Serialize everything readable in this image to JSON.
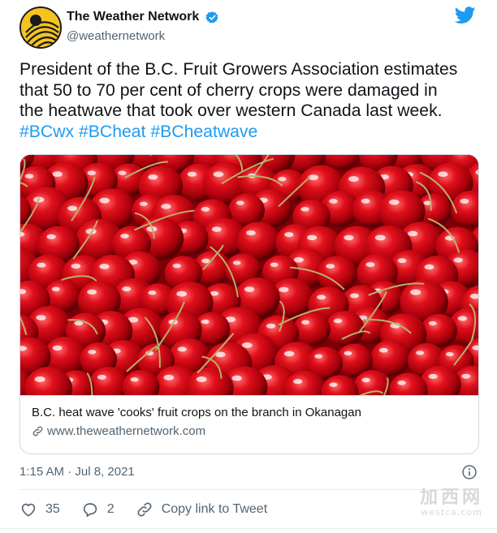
{
  "account": {
    "display_name": "The Weather Network",
    "handle": "@weathernetwork",
    "avatar_icon": "weather-network-logo-icon",
    "verified_icon": "verified-badge-icon",
    "platform_icon": "twitter-bird-icon",
    "colors": {
      "avatar_yellow": "#f4c320",
      "verified_blue": "#1d9bf0",
      "twitter_blue": "#1d9bf0"
    }
  },
  "tweet": {
    "text_lines": [
      "President of the B.C. Fruit Growers Association estimates",
      "that 50 to 70 per cent of cherry crops were damaged in",
      "the heatwave that took over western Canada last week."
    ],
    "hashtags": [
      "#BCwx",
      "#BCheat",
      "#BCheatwave"
    ],
    "hashtag_color": "#1d9bf0"
  },
  "card": {
    "image_description_icon": "cherries-photo",
    "title": "B.C. heat wave 'cooks' fruit crops on the branch in Okanagan",
    "domain": "www.theweathernetwork.com",
    "link_icon": "link-icon"
  },
  "meta": {
    "timestamp": "1:15 AM · Jul 8, 2021",
    "info_icon": "info-icon"
  },
  "actions": {
    "likes": "35",
    "replies": "2",
    "copy_link_label": "Copy link to Tweet"
  },
  "watermark": {
    "top": "加西网",
    "bottom": "westca.com"
  }
}
